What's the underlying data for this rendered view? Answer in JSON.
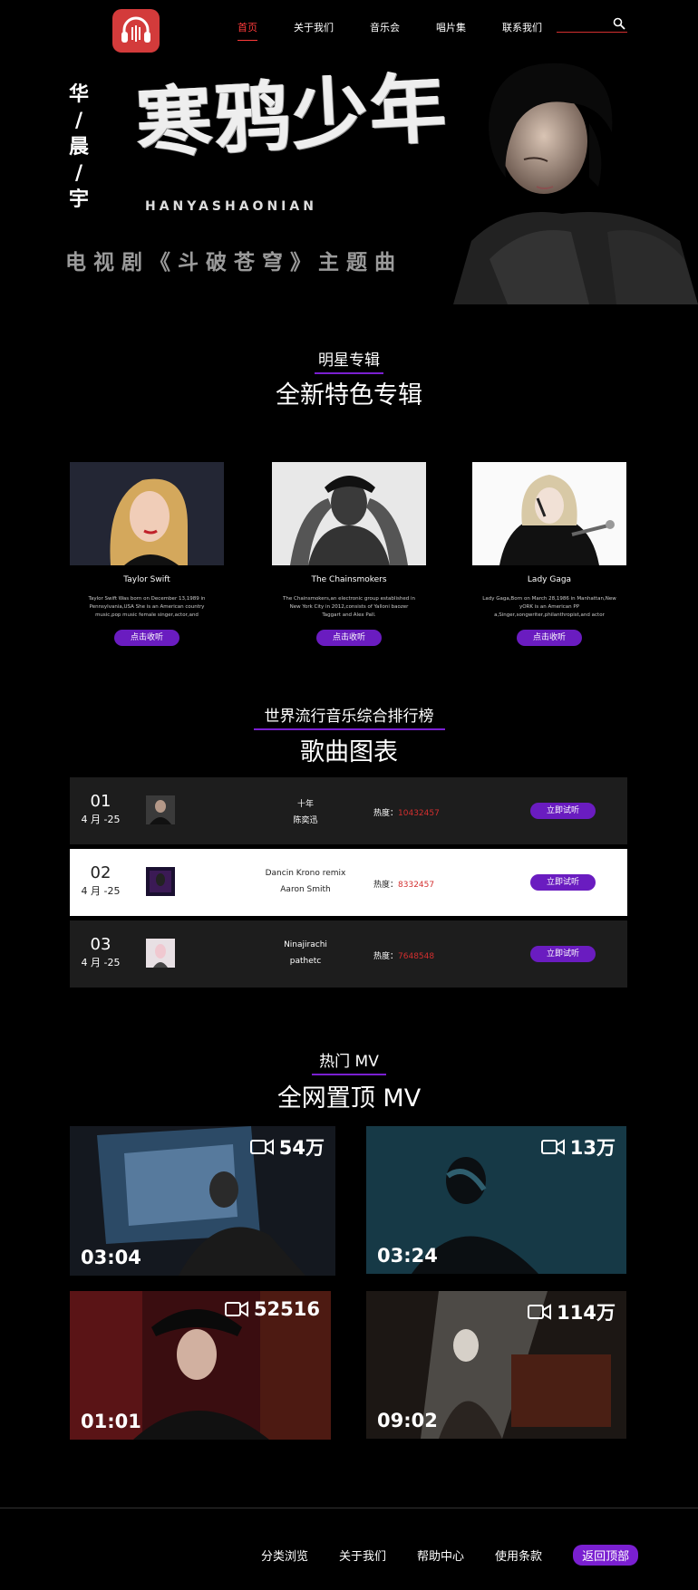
{
  "nav": {
    "items": [
      "首页",
      "关于我们",
      "音乐会",
      "唱片集",
      "联系我们"
    ],
    "active_index": 0,
    "search_placeholder": ""
  },
  "hero": {
    "vertical_text": [
      "华",
      "/",
      "晨",
      "/",
      "宇"
    ],
    "title": "寒鸦少年",
    "pinyin": "HANYASHAONIAN",
    "subtitle": "电视剧《斗破苍穹》主题曲"
  },
  "albums_section": {
    "kicker": "明星专辑",
    "title": "全新特色专辑",
    "items": [
      {
        "name": "Taylor Swift",
        "desc": "Taylor Swift Was born on December 13,1989 in Pennsylvania,USA She is an American country music,pop music female singer,actor,and philanthropist",
        "button": "点击收听"
      },
      {
        "name": "The Chainsmokers",
        "desc": "The Chainsmokers,an electronic group established in New York City in 2012,consists of Yalloni baozer Taggart and Alex Pall.",
        "button": "点击收听"
      },
      {
        "name": "Lady Gaga",
        "desc": "Lady Gaga,Born on March 28,1986 in Manhattan,New yORK is an American PP a,Singer,songwriter,philanthropist,and actor",
        "button": "点击收听"
      }
    ]
  },
  "chart_section": {
    "kicker": "世界流行音乐综合排行榜",
    "title": "歌曲图表",
    "heat_label": "热度：",
    "rows": [
      {
        "rank": "01",
        "date": "4 月 -25",
        "title": "十年",
        "artist": "陈奕迅",
        "heat": "10432457",
        "button": "立即试听"
      },
      {
        "rank": "02",
        "date": "4 月 -25",
        "title": "Dancin Krono remix",
        "artist": "Aaron Smith",
        "heat": "8332457",
        "button": "立即试听"
      },
      {
        "rank": "03",
        "date": "4 月 -25",
        "title": "Ninajirachi",
        "artist": "pathetc",
        "heat": "7648548",
        "button": "立即试听"
      }
    ]
  },
  "mv_section": {
    "kicker": "热门 MV",
    "title": "全网置顶 MV",
    "items": [
      {
        "views": "54万",
        "duration": "03:04"
      },
      {
        "views": "13万",
        "duration": "03:24"
      },
      {
        "views": "52516",
        "duration": "01:01"
      },
      {
        "views": "114万",
        "duration": "09:02"
      }
    ]
  },
  "footer": {
    "links": [
      "分类浏览",
      "关于我们",
      "帮助中心",
      "使用条款"
    ],
    "back_to_top": "返回顶部"
  },
  "colors": {
    "accent_purple": "#6a1cc0",
    "nav_active_red": "#ff3b3b",
    "heat_red": "#d32f2f",
    "logo_red": "#d33b3b"
  }
}
